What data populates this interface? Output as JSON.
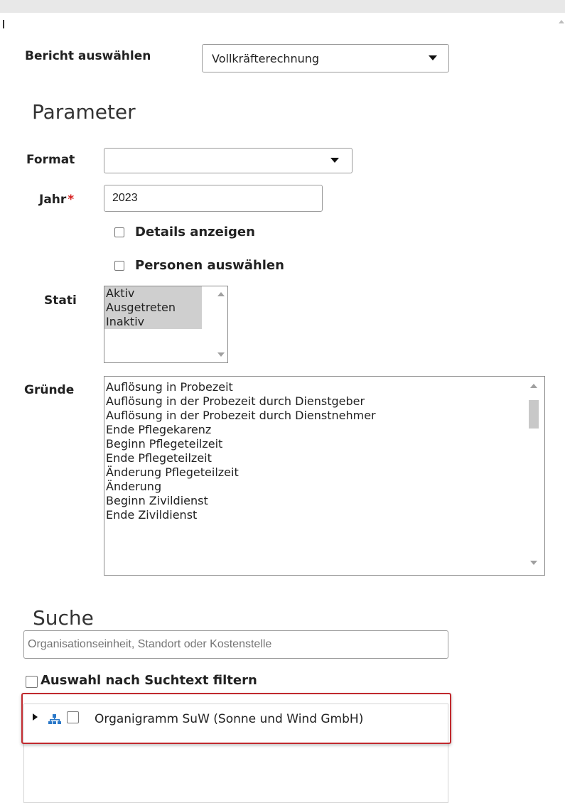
{
  "report": {
    "label": "Bericht auswählen",
    "value": "Vollkräfterechnung"
  },
  "parameters": {
    "heading": "Parameter",
    "format": {
      "label": "Format",
      "value": ""
    },
    "year": {
      "label": "Jahr",
      "required_mark": "*",
      "value": "2023"
    },
    "details_label": "Details anzeigen",
    "persons_label": "Personen auswählen",
    "status": {
      "label": "Stati",
      "options": [
        "Aktiv",
        "Ausgetreten",
        "Inaktiv"
      ]
    },
    "reasons": {
      "label": "Gründe",
      "options": [
        "Auflösung in Probezeit",
        "Auflösung in der Probezeit durch Dienstgeber",
        "Auflösung in der Probezeit durch Dienstnehmer",
        "Ende Pflegekarenz",
        "Beginn Pflegeteilzeit",
        "Ende Pflegeteilzeit",
        "Änderung Pflegeteilzeit",
        "Änderung",
        "Beginn Zivildienst",
        "Ende Zivildienst"
      ]
    }
  },
  "search": {
    "heading": "Suche",
    "placeholder": "Organisationseinheit, Standort oder Kostenstelle",
    "filter_label": "Auswahl nach Suchtext filtern"
  },
  "tree": {
    "root_label": "Organigramm SuW (Sonne und Wind GmbH)"
  },
  "colors": {
    "highlight_border": "#c0282d",
    "selected_option": "#cfcfcf",
    "org_icon": "#2a78c8",
    "required": "#d62020"
  },
  "icons": [
    "caret-down-icon",
    "expand-triangle-icon",
    "org-chart-icon",
    "scroll-up-icon",
    "scroll-down-icon"
  ]
}
